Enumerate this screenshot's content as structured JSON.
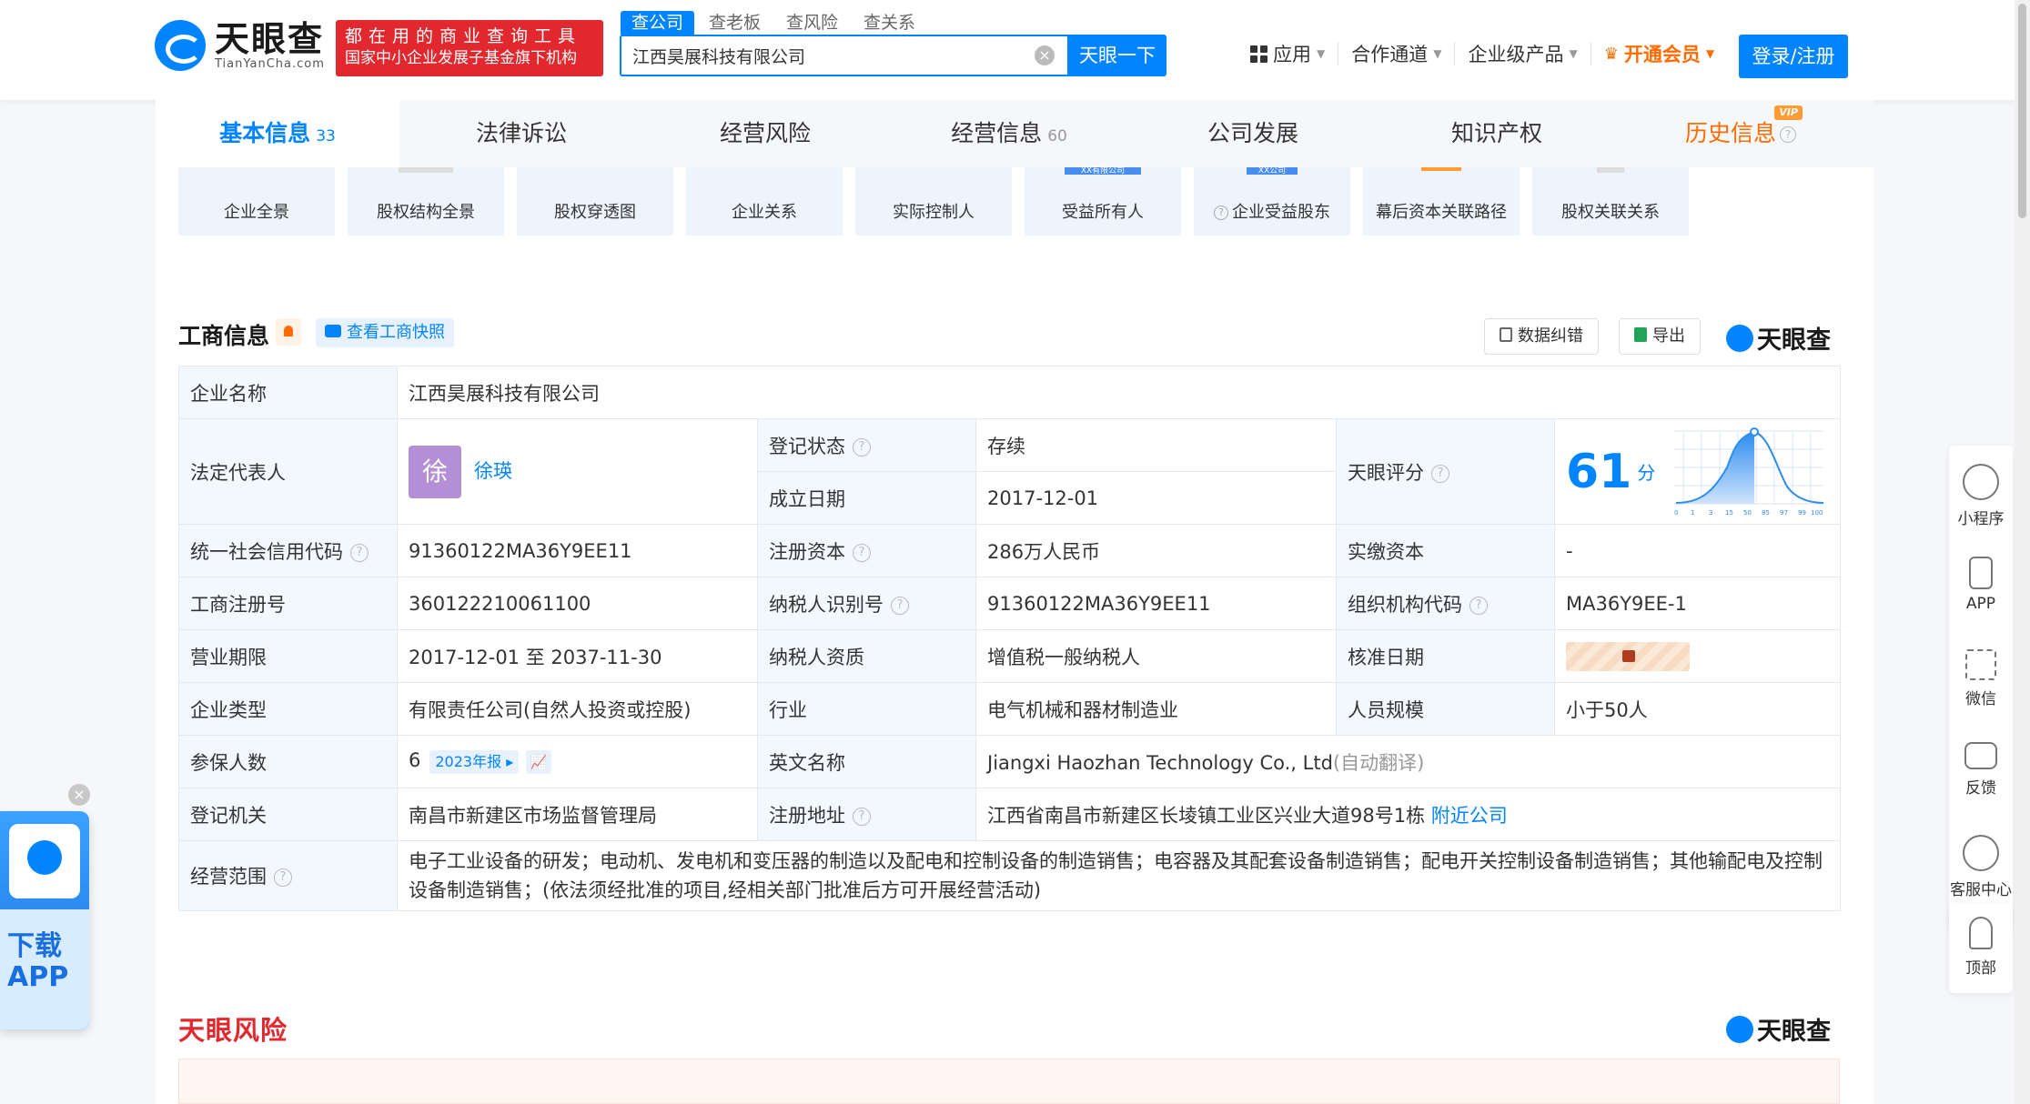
{
  "header": {
    "logo_cn": "天眼查",
    "logo_en": "TianYanCha.com",
    "slogan_line1": "都在用的商业查询工具",
    "slogan_line2": "国家中小企业发展子基金旗下机构",
    "search_tabs": [
      "查公司",
      "查老板",
      "查风险",
      "查关系"
    ],
    "search_value": "江西昊展科技有限公司",
    "search_button": "天眼一下",
    "nav": {
      "apps": "应用",
      "partner": "合作通道",
      "enterprise": "企业级产品",
      "vip": "开通会员"
    },
    "login": "登录/注册"
  },
  "tabs": [
    {
      "label": "基本信息",
      "count": "33"
    },
    {
      "label": "法律诉讼",
      "count": ""
    },
    {
      "label": "经营风险",
      "count": ""
    },
    {
      "label": "经营信息",
      "count": "60"
    },
    {
      "label": "公司发展",
      "count": ""
    },
    {
      "label": "知识产权",
      "count": ""
    },
    {
      "label": "历史信息",
      "count": "",
      "badge": "VIP"
    }
  ],
  "graph_cards": [
    "企业全景",
    "股权结构全景",
    "股权穿透图",
    "企业关系",
    "实际控制人",
    "受益所有人",
    "企业受益股东",
    "幕后资本关联路径",
    "股权关联关系"
  ],
  "graph_decor": {
    "beneficiary_card": "XX有限公司",
    "equity_card": "XX公司"
  },
  "section": {
    "title": "工商信息",
    "snapshot": "查看工商快照",
    "correct": "数据纠错",
    "export": "导出",
    "brand": "天眼查"
  },
  "info": {
    "company_name_label": "企业名称",
    "company_name": "江西昊展科技有限公司",
    "legal_rep_label": "法定代表人",
    "legal_rep_avatar": "徐",
    "legal_rep": "徐瑛",
    "reg_status_label": "登记状态",
    "reg_status": "存续",
    "found_date_label": "成立日期",
    "found_date": "2017-12-01",
    "score_label": "天眼评分",
    "score": "61",
    "score_unit": "分",
    "score_axis": [
      "0",
      "1",
      "3",
      "15",
      "50",
      "85",
      "97",
      "99",
      "100"
    ],
    "credit_code_label": "统一社会信用代码",
    "credit_code": "91360122MA36Y9EE11",
    "reg_capital_label": "注册资本",
    "reg_capital": "286万人民币",
    "paid_capital_label": "实缴资本",
    "paid_capital": "-",
    "reg_no_label": "工商注册号",
    "reg_no": "360122210061100",
    "taxpayer_id_label": "纳税人识别号",
    "taxpayer_id": "91360122MA36Y9EE11",
    "org_code_label": "组织机构代码",
    "org_code": "MA36Y9EE-1",
    "term_label": "营业期限",
    "term": "2017-12-01 至 2037-11-30",
    "taxpayer_qual_label": "纳税人资质",
    "taxpayer_qual": "增值税一般纳税人",
    "approve_date_label": "核准日期",
    "type_label": "企业类型",
    "type": "有限责任公司(自然人投资或控股)",
    "industry_label": "行业",
    "industry": "电气机械和器材制造业",
    "staff_label": "人员规模",
    "staff": "小于50人",
    "insured_label": "参保人数",
    "insured": "6",
    "insured_report": "2023年报",
    "en_name_label": "英文名称",
    "en_name": "Jiangxi Haozhan Technology Co., Ltd",
    "en_name_note": "(自动翻译)",
    "authority_label": "登记机关",
    "authority": "南昌市新建区市场监督管理局",
    "address_label": "注册地址",
    "address": "江西省南昌市新建区长堎镇工业区兴业大道98号1栋",
    "nearby": "附近公司",
    "scope_label": "经营范围",
    "scope": "电子工业设备的研发；电动机、发电机和变压器的制造以及配电和控制设备的制造销售；电容器及其配套设备制造销售；配电开关控制设备制造销售；其他输配电及控制设备制造销售；(依法须经批准的项目,经相关部门批准后方可开展经营活动)"
  },
  "risk": {
    "title": "天眼风险",
    "brand": "天眼查"
  },
  "sidebar": [
    "小程序",
    "APP",
    "微信",
    "反馈",
    "客服中心"
  ],
  "top_label": "顶部",
  "download": {
    "line1": "下载",
    "line2": "APP"
  },
  "colors": {
    "brand_blue": "#0084ff",
    "slogan_red": "#e0282e",
    "vip_orange": "#ff6b00",
    "status_green": "#22a35a"
  }
}
